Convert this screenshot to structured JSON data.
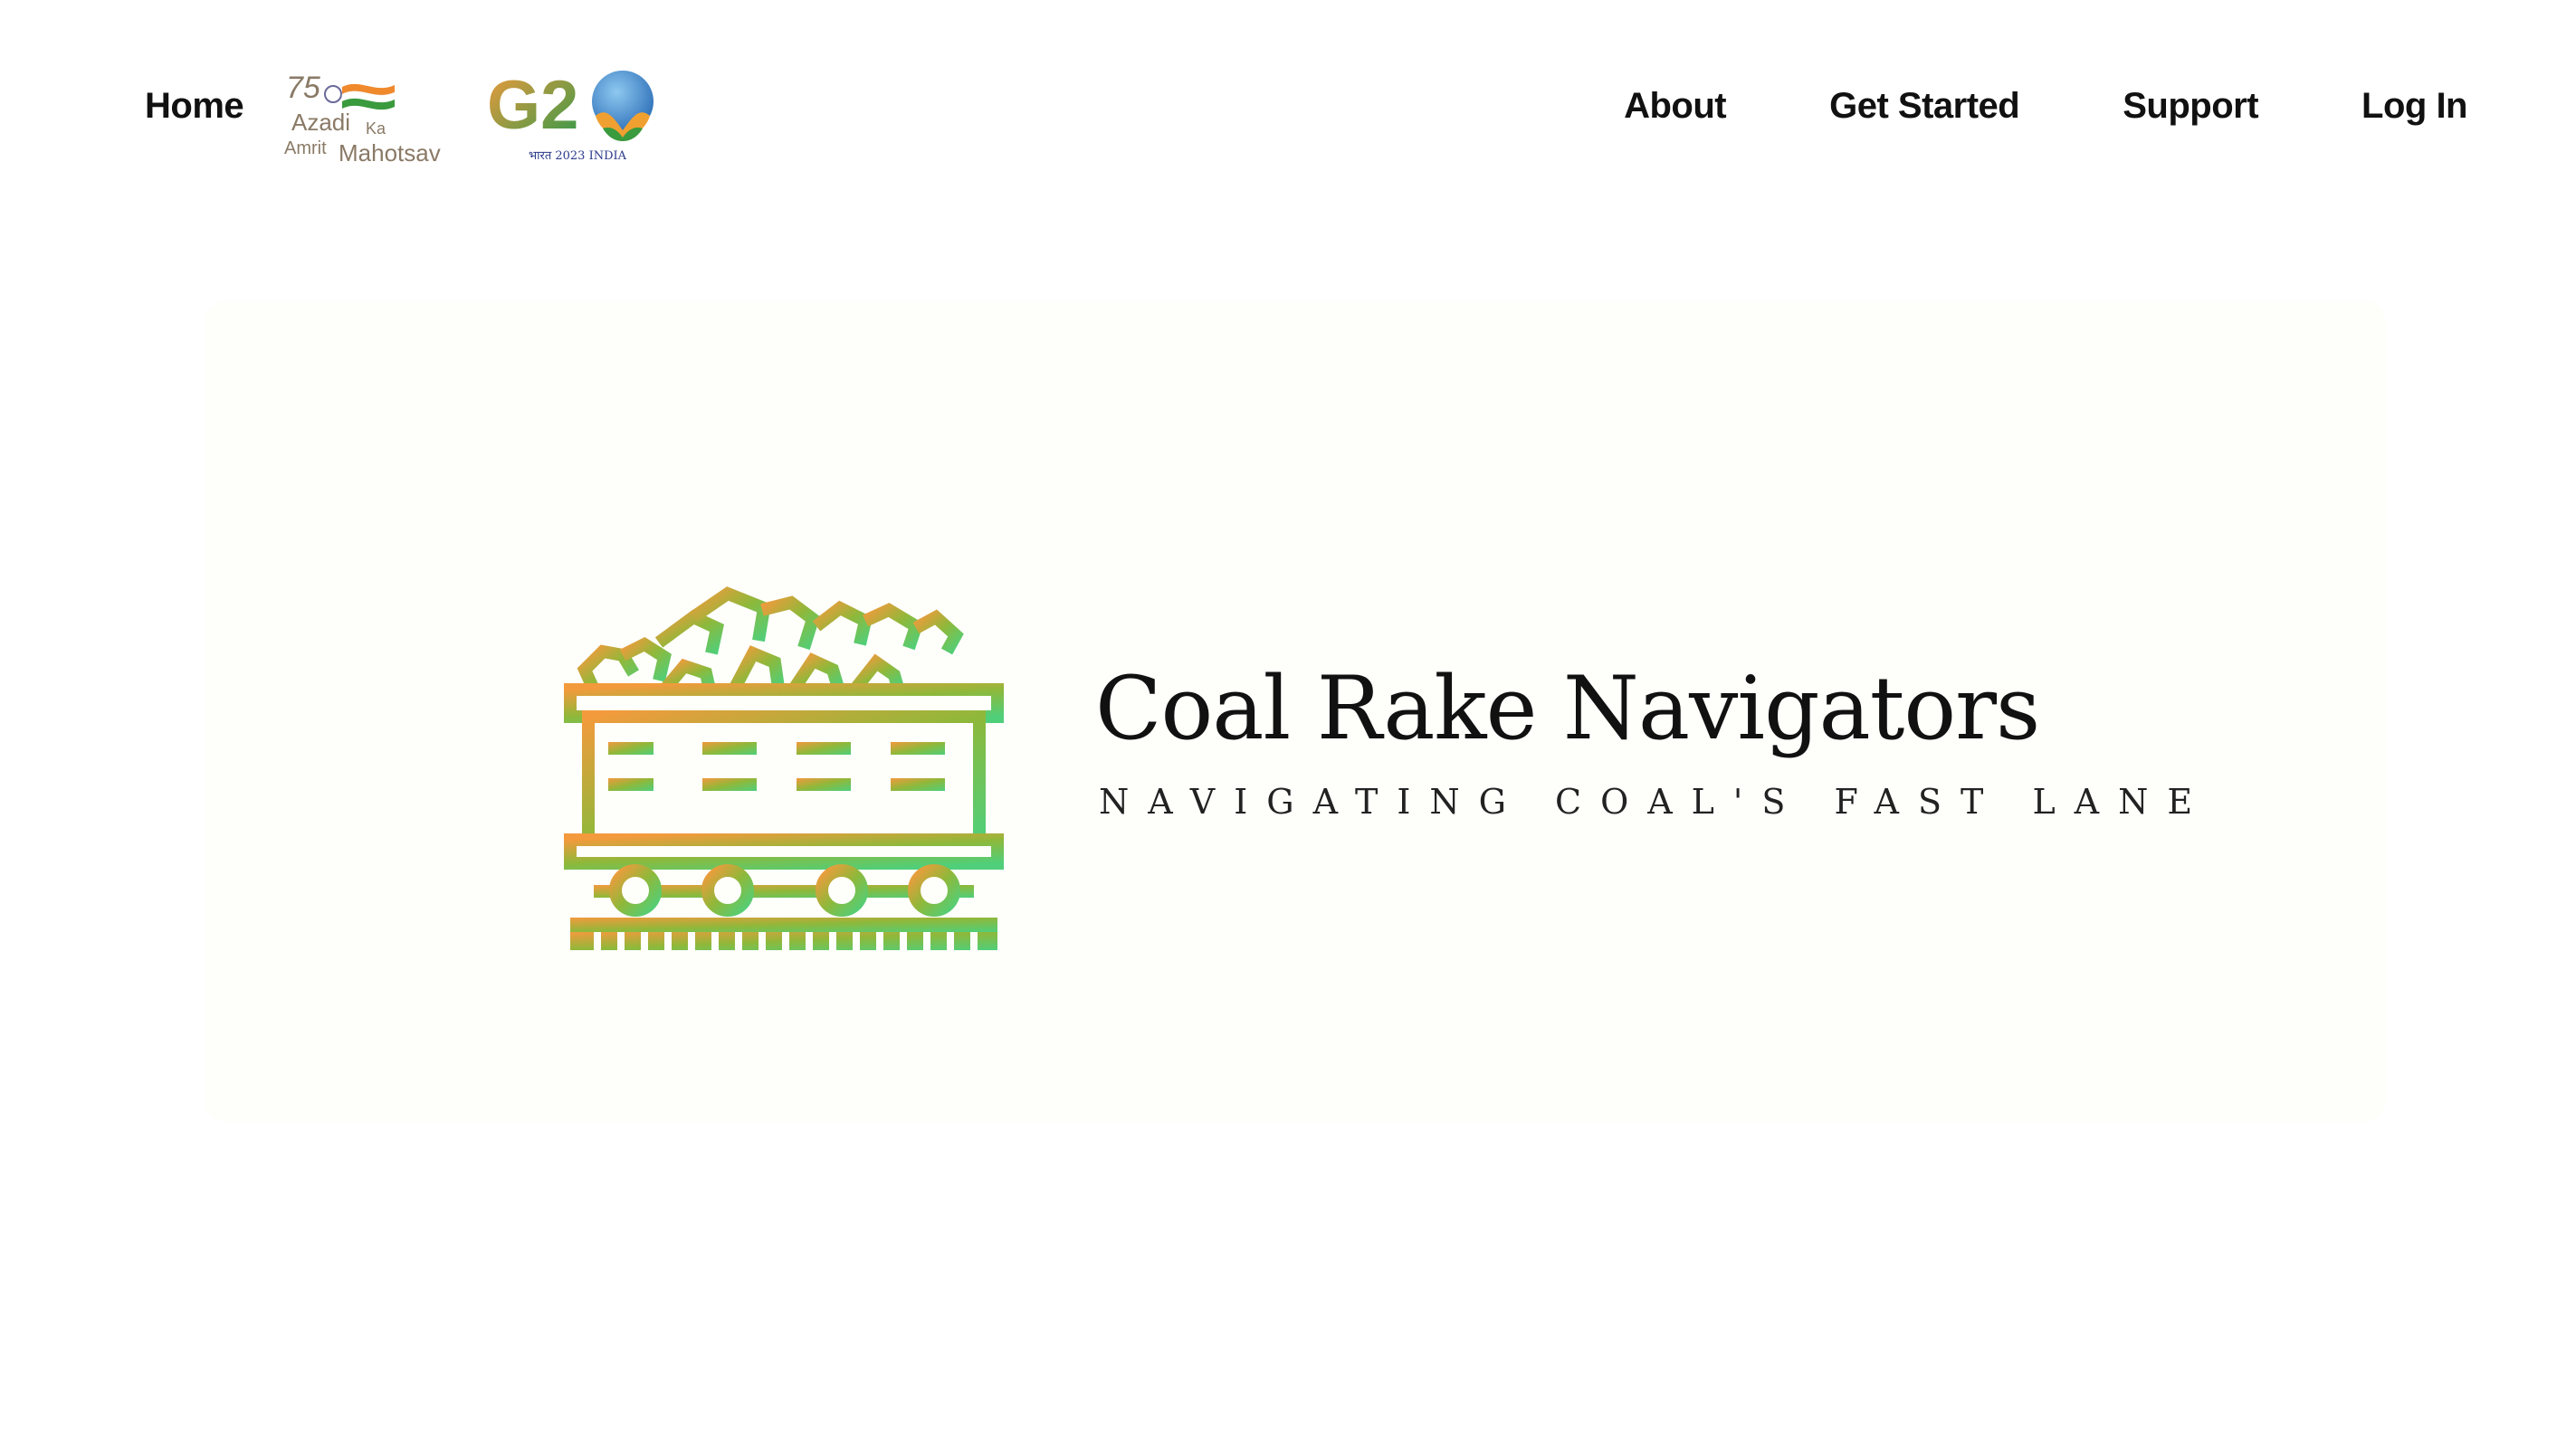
{
  "nav": {
    "home_label": "Home",
    "akam_logo": {
      "number": "75",
      "line1": "Azadi",
      "ka": "Ka",
      "line2": "Amrit",
      "line3": "Mahotsav"
    },
    "g20_logo": {
      "text": "G20",
      "subtitle": "भारत 2023 INDIA"
    },
    "links": {
      "about": "About",
      "get_started": "Get Started",
      "support": "Support",
      "log_in": "Log In"
    }
  },
  "hero": {
    "logo_icon": "coal-rake-train-icon",
    "title": "Coal Rake Navigators",
    "tagline": "NAVIGATING COAL'S FAST LANE"
  },
  "colors": {
    "text": "#111111",
    "card_background": "#fefefb",
    "gradient_start": "#f39a3c",
    "gradient_mid": "#8fb83a",
    "gradient_end": "#4fcf7a"
  }
}
